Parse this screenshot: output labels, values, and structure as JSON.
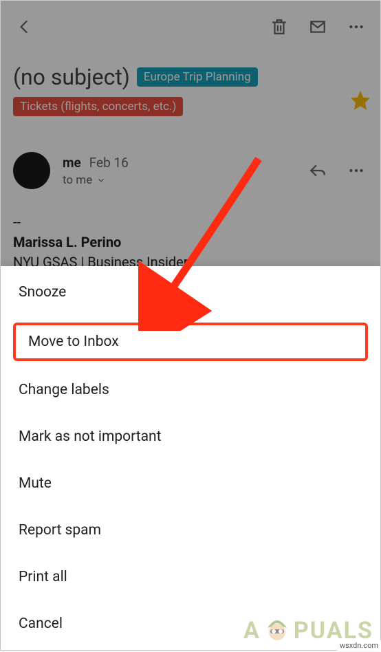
{
  "email": {
    "subject": "(no subject)",
    "labels": {
      "trip": "Europe Trip Planning",
      "tickets": "Tickets (flights, concerts, etc.)"
    },
    "sender_name": "me",
    "date": "Feb 16",
    "to_line": "to me",
    "body_divider": "--",
    "sig_name": "Marissa L. Perino",
    "sig_line2": "NYU GSAS | Business Insider"
  },
  "sheet": {
    "snooze": "Snooze",
    "move_to_inbox": "Move to Inbox",
    "change_labels": "Change labels",
    "mark_not_important": "Mark as not important",
    "mute": "Mute",
    "report_spam": "Report spam",
    "print_all": "Print all",
    "cancel": "Cancel"
  },
  "watermark": {
    "prefix": "A",
    "suffix": "PUALS"
  },
  "credit": "wsxdn.com"
}
